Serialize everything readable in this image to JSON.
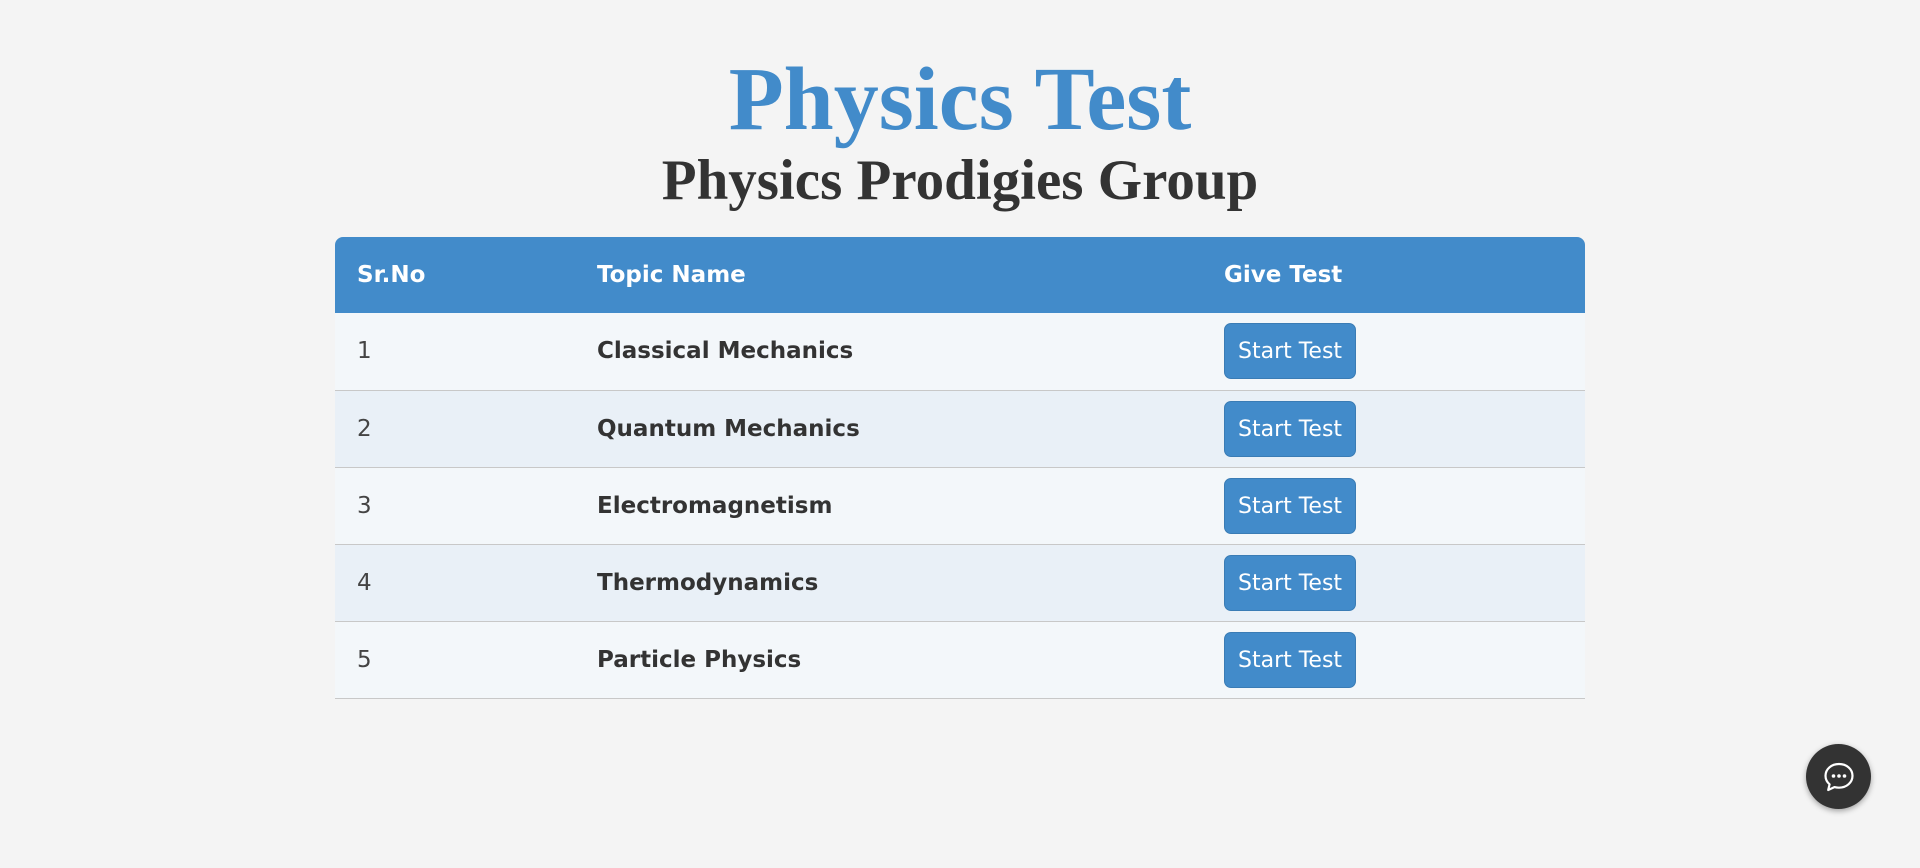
{
  "header": {
    "title": "Physics Test",
    "subtitle": "Physics Prodigies Group"
  },
  "table": {
    "columns": [
      "Sr.No",
      "Topic Name",
      "Give Test"
    ],
    "rows": [
      {
        "num": "1",
        "topic": "Classical Mechanics",
        "action": "Start Test"
      },
      {
        "num": "2",
        "topic": "Quantum Mechanics",
        "action": "Start Test"
      },
      {
        "num": "3",
        "topic": "Electromagnetism",
        "action": "Start Test"
      },
      {
        "num": "4",
        "topic": "Thermodynamics",
        "action": "Start Test"
      },
      {
        "num": "5",
        "topic": "Particle Physics",
        "action": "Start Test"
      }
    ]
  },
  "chat": {
    "icon": "chat-bubble-icon"
  },
  "colors": {
    "accent": "#428bca",
    "background": "#f4f4f4",
    "text": "#333333",
    "chat_button": "#333333"
  }
}
